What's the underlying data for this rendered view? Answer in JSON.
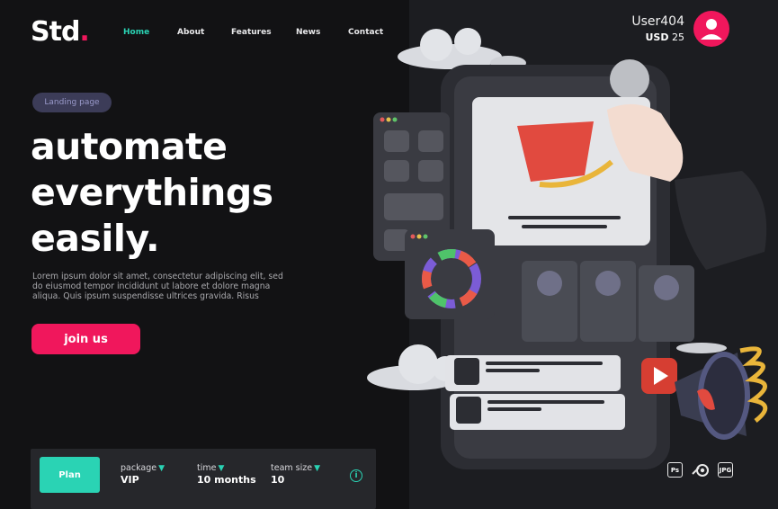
{
  "logo": {
    "text": "Std",
    "dot": "."
  },
  "nav": {
    "items": [
      {
        "label": "Home",
        "active": true
      },
      {
        "label": "About",
        "active": false
      },
      {
        "label": "Features",
        "active": false
      },
      {
        "label": "News",
        "active": false
      },
      {
        "label": "Contact",
        "active": false
      }
    ]
  },
  "user": {
    "name": "User404",
    "currency": "USD",
    "amount": "25"
  },
  "badge": "Landing page",
  "hero": {
    "line1": "automate",
    "line2": "everythings",
    "line3": "easily."
  },
  "description": "Lorem ipsum dolor sit amet, consectetur adipiscing elit, sed do eiusmod tempor incididunt ut labore et dolore magna aliqua. Quis ipsum suspendisse ultrices gravida. Risus",
  "cta": "join us",
  "plan_bar": {
    "button": "Plan",
    "options": [
      {
        "label": "package",
        "value": "VIP"
      },
      {
        "label": "time",
        "value": "10 months"
      },
      {
        "label": "team size",
        "value": "10"
      }
    ],
    "info_icon": "i"
  },
  "file_formats": [
    "Ps",
    "JPG"
  ],
  "colors": {
    "accent_pink": "#f0175c",
    "accent_teal": "#2ad3b4",
    "background": "#121214"
  }
}
